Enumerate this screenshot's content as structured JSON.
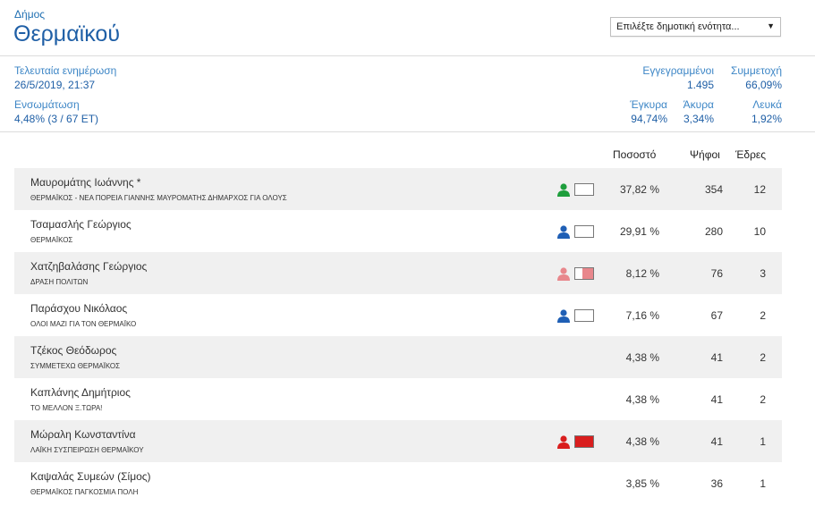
{
  "header": {
    "label": "Δήμος",
    "name": "Θερμαϊκού",
    "select_value": "Επιλέξτε δημοτική ενότητα..."
  },
  "info": {
    "last_update_label": "Τελευταία ενημέρωση",
    "last_update_value": "26/5/2019, 21:37",
    "integration_label": "Ενσωμάτωση",
    "integration_value": "4,48% (3 / 67 ΕΤ)",
    "registered_label": "Εγγεγραμμένοι",
    "registered_value": "1.495",
    "participation_label": "Συμμετοχή",
    "participation_value": "66,09%",
    "valid_label": "Έγκυρα",
    "valid_value": "94,74%",
    "invalid_label": "Άκυρα",
    "invalid_value": "3,34%",
    "blank_label": "Λευκά",
    "blank_value": "1,92%"
  },
  "columns": {
    "percent": "Ποσοστό",
    "votes": "Ψήφοι",
    "seats": "Έδρες"
  },
  "rows": [
    {
      "candidate": "Μαυρομάτης Ιωάννης *",
      "party": "ΘΕΡΜΑΪΚΟΣ - ΝΕΑ ΠΟΡΕΙΑ ΓΙΑΝΝΗΣ ΜΑΥΡΟΜΑΤΗΣ ΔΗΜΑΡΧΟΣ ΓΙΑ ΟΛΟΥΣ",
      "percent": "37,82 %",
      "votes": "354",
      "seats": "12",
      "icon_color": "#1e9e3c",
      "fill_color": "#1e9e3c",
      "fill_fraction": 0
    },
    {
      "candidate": "Τσαμασλής Γεώργιος",
      "party": "ΘΕΡΜΑΪΚΟΣ",
      "percent": "29,91 %",
      "votes": "280",
      "seats": "10",
      "icon_color": "#1f5fb5",
      "fill_color": "#1f5fb5",
      "fill_fraction": 0
    },
    {
      "candidate": "Χατζηβαλάσης Γεώργιος",
      "party": "ΔΡΑΣΗ ΠΟΛΙΤΩΝ",
      "percent": "8,12 %",
      "votes": "76",
      "seats": "3",
      "icon_color": "#e8878c",
      "fill_color": "#e8878c",
      "fill_fraction": 0.6
    },
    {
      "candidate": "Παράσχου Νικόλαος",
      "party": "ΟΛΟΙ ΜΑΖΙ ΓΙΑ ΤΟΝ ΘΕΡΜΑΪΚΟ",
      "percent": "7,16 %",
      "votes": "67",
      "seats": "2",
      "icon_color": "#1f5fb5",
      "fill_color": "#1f5fb5",
      "fill_fraction": 0
    },
    {
      "candidate": "Τζέκος Θεόδωρος",
      "party": "ΣΥΜΜΕΤΕΧΩ ΘΕΡΜΑΪΚΟΣ",
      "percent": "4,38 %",
      "votes": "41",
      "seats": "2"
    },
    {
      "candidate": "Καπλάνης Δημήτριος",
      "party": "ΤΟ ΜΕΛΛΟΝ Ξ.ΤΩΡΑ!",
      "percent": "4,38 %",
      "votes": "41",
      "seats": "2"
    },
    {
      "candidate": "Μώραλη Κωνσταντίνα",
      "party": "ΛΑΪΚΗ ΣΥΣΠΕΙΡΩΣΗ ΘΕΡΜΑΪΚΟΥ",
      "percent": "4,38 %",
      "votes": "41",
      "seats": "1",
      "icon_color": "#d91e1e",
      "fill_color": "#d91e1e",
      "fill_fraction": 1
    },
    {
      "candidate": "Καψαλάς Συμεών (Σίμος)",
      "party": "ΘΕΡΜΑΪΚΟΣ ΠΑΓΚΟΣΜΙΑ ΠΟΛΗ",
      "percent": "3,85 %",
      "votes": "36",
      "seats": "1"
    }
  ]
}
